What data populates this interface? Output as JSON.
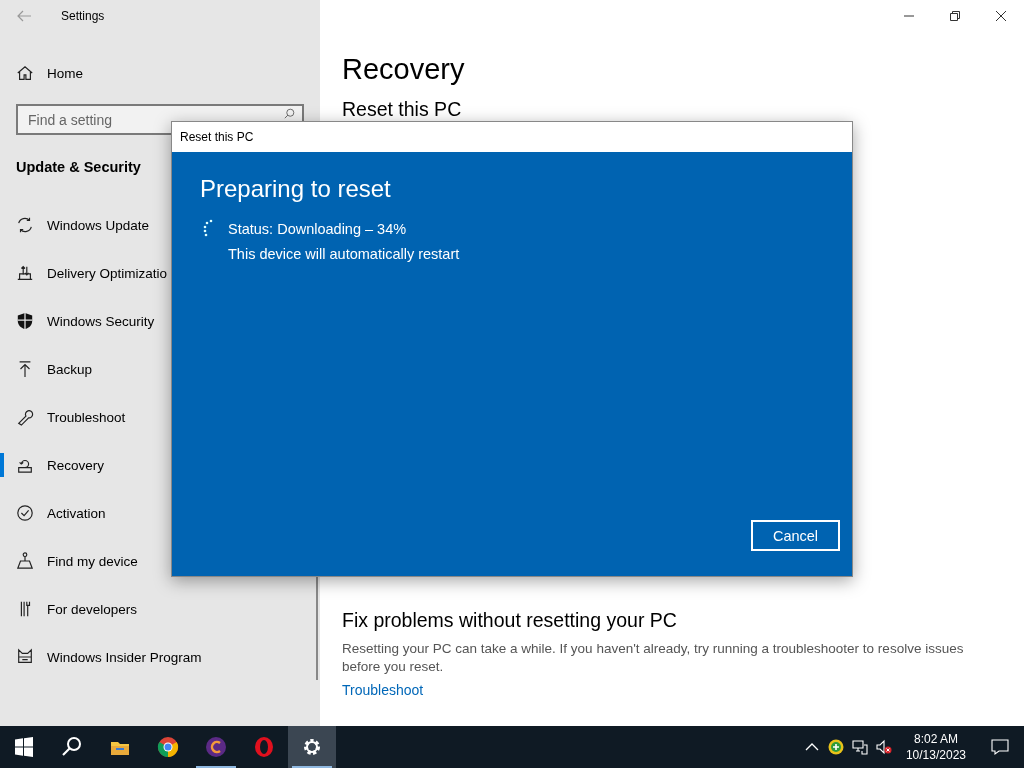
{
  "window": {
    "title": "Settings"
  },
  "sidebar": {
    "home": "Home",
    "search": {
      "placeholder": "Find a setting"
    },
    "section": "Update & Security",
    "items": [
      {
        "label": "Windows Update",
        "selected": false
      },
      {
        "label": "Delivery Optimizatio",
        "selected": false
      },
      {
        "label": "Windows Security",
        "selected": false
      },
      {
        "label": "Backup",
        "selected": false
      },
      {
        "label": "Troubleshoot",
        "selected": false
      },
      {
        "label": "Recovery",
        "selected": true
      },
      {
        "label": "Activation",
        "selected": false
      },
      {
        "label": "Find my device",
        "selected": false
      },
      {
        "label": "For developers",
        "selected": false
      },
      {
        "label": "Windows Insider Program",
        "selected": false
      }
    ]
  },
  "main": {
    "title": "Recovery",
    "sections": [
      {
        "heading": "Reset this PC"
      },
      {
        "heading": "Fix problems without resetting your PC",
        "text": "Resetting your PC can take a while. If you haven't already, try running a troubleshooter to resolve issues before you reset.",
        "link": "Troubleshoot"
      }
    ]
  },
  "dialog": {
    "title": "Reset this PC",
    "heading": "Preparing to reset",
    "status": "Status: Downloading – 34%",
    "note": "This device will automatically restart",
    "button": "Cancel"
  },
  "taskbar": {
    "apps": [
      {
        "running": false,
        "selected": false
      },
      {
        "running": false,
        "selected": false
      },
      {
        "running": true,
        "selected": false
      },
      {
        "running": false,
        "selected": false
      },
      {
        "running": true,
        "selected": true
      }
    ],
    "tray": {
      "time": "8:02 AM",
      "date": "10/13/2023"
    }
  }
}
